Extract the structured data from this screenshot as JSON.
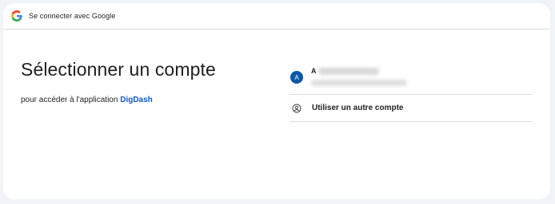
{
  "header": {
    "logo_icon": "google-g-icon",
    "title": "Se connecter avec Google"
  },
  "main": {
    "title": "Sélectionner un compte",
    "subtitle_prefix": "pour accéder à l'application ",
    "app_name": "DigDash"
  },
  "accounts": [
    {
      "avatar_letter": "A",
      "name_visible": "A",
      "avatar_color": "#0b57a8"
    }
  ],
  "other_account": {
    "icon": "person-circle-icon",
    "label": "Utiliser un autre compte"
  },
  "colors": {
    "background": "#f0f4f9",
    "card": "#ffffff",
    "link": "#0b57d0",
    "divider": "#dadce0"
  }
}
